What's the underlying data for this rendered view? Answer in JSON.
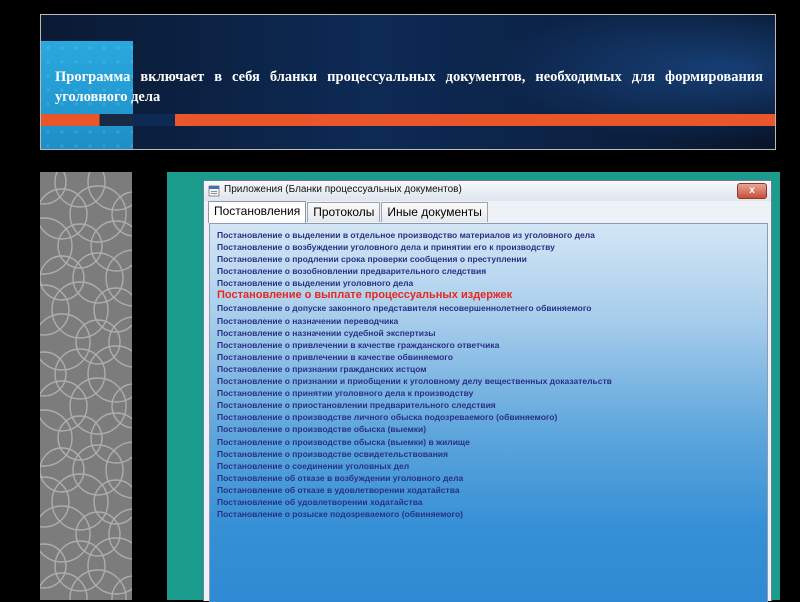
{
  "banner": {
    "title": "Программа включает в себя бланки процессуальных документов, необходимых для формирования уголовного дела"
  },
  "window": {
    "title": "Приложения (Бланки процессуальных документов)",
    "close_label": "x",
    "tabs": [
      {
        "label": "Постановления",
        "active": true
      },
      {
        "label": "Протоколы",
        "active": false
      },
      {
        "label": "Иные документы",
        "active": false
      }
    ],
    "highlight_color": "#e8271f",
    "item_color": "#2a2f86",
    "items": [
      {
        "label": "Постановление о  выделении в отдельное производство материалов из уголовного дела"
      },
      {
        "label": "Постановление о возбуждении  уголовного дела и принятии его к производству"
      },
      {
        "label": "Постановление о продлении срока проверки сообщения о преступлении"
      },
      {
        "label": "Постановление о возобновлении предварительного следствия"
      },
      {
        "label": "Постановление о выделении уголовного дела"
      },
      {
        "label": "Постановление о выплате процессуальных издержек",
        "highlighted": true
      },
      {
        "label": "Постановление о допуске законного представителя несовершеннолетнего обвиняемого"
      },
      {
        "label": "Постановление о назначении переводчика"
      },
      {
        "label": "Постановление о назначении судебной экспертизы"
      },
      {
        "label": "Постановление о привлечении в качестве гражданского ответчика"
      },
      {
        "label": "Постановление о привлечении в качестве обвиняемого"
      },
      {
        "label": "Постановление о признании гражданских истцом"
      },
      {
        "label": "Постановление о признании и приобщении к уголовному делу вещественных доказательств"
      },
      {
        "label": "Постановление о принятии уголовного дела к производству"
      },
      {
        "label": "Постановление о приостановлении предварительного следствия"
      },
      {
        "label": "Постановление о производстве личного обыска подозреваемого (обвиняемого)"
      },
      {
        "label": "Постановление о производстве обыска (выемки)"
      },
      {
        "label": "Постановление о производстве обыска (выемки) в жилище"
      },
      {
        "label": "Постановление о производстве освидетельствования"
      },
      {
        "label": "Постановление о соединении уголовных дел"
      },
      {
        "label": "Постановление об отказе в возбуждении уголовного дела"
      },
      {
        "label": "Постановление об отказе в удовлетворении ходатайства"
      },
      {
        "label": "Постановление об удовлетворении ходатайства"
      },
      {
        "label": "Постановление о розыске подозреваемого (обвиняемого)"
      }
    ]
  }
}
